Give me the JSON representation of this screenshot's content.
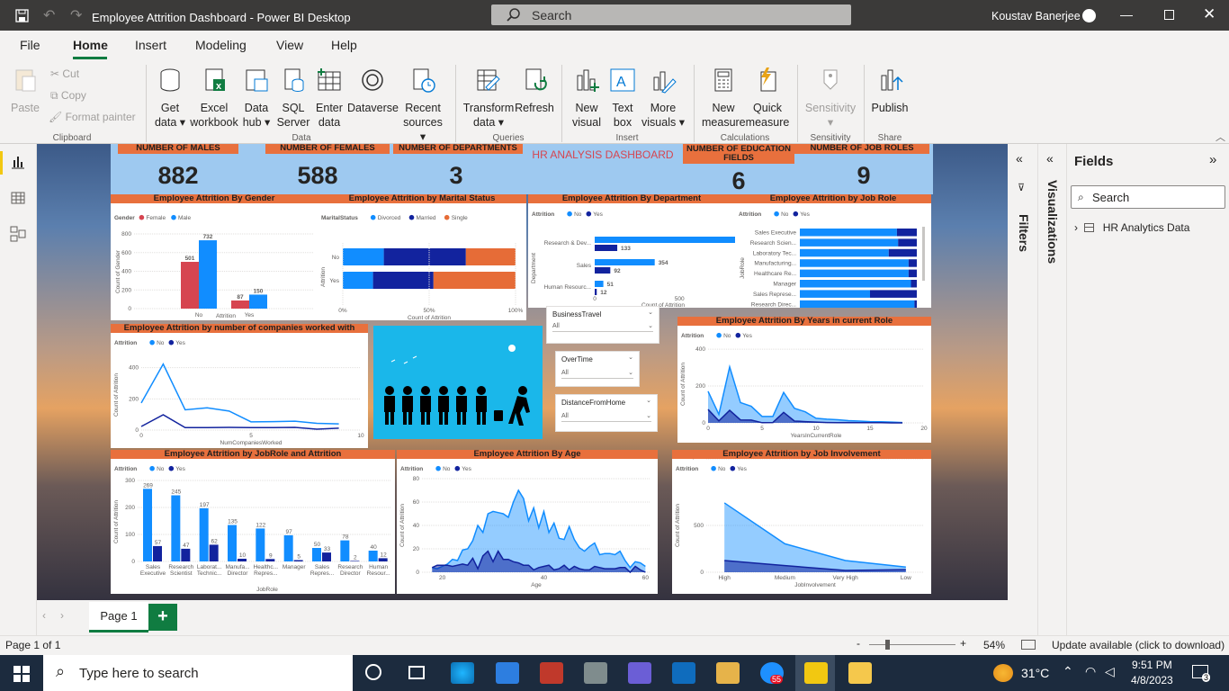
{
  "window": {
    "title": "Employee Attrition Dashboard - Power BI Desktop",
    "search_placeholder": "Search",
    "user": "Koustav Banerjee"
  },
  "menu": [
    "File",
    "Home",
    "Insert",
    "Modeling",
    "View",
    "Help"
  ],
  "ribbon": {
    "clipboard": {
      "paste": "Paste",
      "cut": "Cut",
      "copy": "Copy",
      "format_painter": "Format painter",
      "group": "Clipboard"
    },
    "data": {
      "get_data": [
        "Get",
        "data"
      ],
      "excel": [
        "Excel",
        "workbook"
      ],
      "data_hub": [
        "Data",
        "hub"
      ],
      "sql": [
        "SQL",
        "Server"
      ],
      "enter": [
        "Enter",
        "data"
      ],
      "dataverse": "Dataverse",
      "recent": [
        "Recent",
        "sources"
      ],
      "group": "Data"
    },
    "queries": {
      "transform": [
        "Transform",
        "data"
      ],
      "refresh": "Refresh",
      "group": "Queries"
    },
    "insert": {
      "new_visual": [
        "New",
        "visual"
      ],
      "text_box": [
        "Text",
        "box"
      ],
      "more_visuals": [
        "More",
        "visuals"
      ],
      "group": "Insert"
    },
    "calculations": {
      "new_measure": [
        "New",
        "measure"
      ],
      "quick_measure": [
        "Quick",
        "measure"
      ],
      "group": "Calculations"
    },
    "sensitivity": {
      "label": "Sensitivity",
      "group": "Sensitivity"
    },
    "share": {
      "publish": "Publish",
      "group": "Share"
    }
  },
  "dashboard": {
    "kpis": [
      {
        "label": "NUMBER OF MALES",
        "value": "882"
      },
      {
        "label": "NUMBER OF FEMALES",
        "value": "588"
      },
      {
        "label": "NUMBER OF DEPARTMENTS",
        "value": "3"
      },
      {
        "label": "NUMBER OF EDUCATION FIELDS",
        "value": "6"
      },
      {
        "label": "NUMBER OF JOB ROLES",
        "value": "9"
      }
    ],
    "title": "HR ANALYSIS DASHBOARD",
    "slicers": [
      {
        "label": "BusinessTravel",
        "value": "All"
      },
      {
        "label": "OverTime",
        "value": "All"
      },
      {
        "label": "DistanceFromHome",
        "value": "All"
      }
    ]
  },
  "chart_data": [
    {
      "type": "bar",
      "title": "Employee Attrition By Gender",
      "legend_title": "Gender",
      "xlabel": "Attrition",
      "ylabel": "Count of Gender",
      "categories": [
        "No",
        "Yes"
      ],
      "series": [
        {
          "name": "Female",
          "values": [
            501,
            87
          ]
        },
        {
          "name": "Male",
          "values": [
            732,
            150
          ]
        }
      ],
      "ylim": [
        0,
        800
      ],
      "yticks": [
        0,
        200,
        400,
        600,
        800
      ],
      "colors": [
        "#d64550",
        "#118dff"
      ]
    },
    {
      "type": "bar",
      "title": "Employee Attrition by Marital Status",
      "legend_title": "MaritalStatus",
      "xlabel": "Count of Attrition",
      "ylabel": "Attrition",
      "categories": [
        "No",
        "Yes"
      ],
      "series": [
        {
          "name": "Divorced",
          "values": [
            0.19,
            0.14
          ]
        },
        {
          "name": "Married",
          "values": [
            0.38,
            0.28
          ]
        },
        {
          "name": "Single",
          "values": [
            0.23,
            0.41
          ]
        }
      ],
      "stacked_100": true,
      "xticks": [
        "0%",
        "50%",
        "100%"
      ],
      "colors": [
        "#118dff",
        "#12239e",
        "#e66c37"
      ]
    },
    {
      "type": "bar",
      "title": "Employee Attrition By Department",
      "legend_title": "Attrition",
      "xlabel": "Count of Attrition",
      "ylabel": "Department",
      "categories": [
        "Research & Dev...",
        "Sales",
        "Human Resourc..."
      ],
      "series": [
        {
          "name": "No",
          "values": [
            828,
            354,
            51
          ]
        },
        {
          "name": "Yes",
          "values": [
            133,
            92,
            12
          ]
        }
      ],
      "xticks": [
        0,
        500
      ],
      "colors": [
        "#118dff",
        "#12239e"
      ]
    },
    {
      "type": "bar",
      "title": "Employee Attrition by Job Role",
      "legend_title": "Attrition",
      "ylabel": "JobRole",
      "categories": [
        "Sales Executive",
        "Research Scien...",
        "Laboratory Tec...",
        "Manufacturing...",
        "Healthcare Re...",
        "Manager",
        "Sales Represe...",
        "Research Direc..."
      ],
      "series": [
        {
          "name": "No",
          "values": [
            0.83,
            0.84,
            0.76,
            0.93,
            0.93,
            0.95,
            0.6,
            0.98
          ]
        },
        {
          "name": "Yes",
          "values": [
            0.17,
            0.16,
            0.24,
            0.07,
            0.07,
            0.05,
            0.4,
            0.02
          ]
        }
      ],
      "stacked_100": true,
      "colors": [
        "#118dff",
        "#12239e"
      ]
    },
    {
      "type": "line",
      "title": "Employee Attrition by number of companies worked with",
      "legend_title": "Attrition",
      "xlabel": "NumCompaniesWorked",
      "ylabel": "Count of Attrition",
      "x": [
        0,
        1,
        2,
        3,
        4,
        5,
        6,
        7,
        8,
        9
      ],
      "series": [
        {
          "name": "No",
          "values": [
            174,
            423,
            130,
            143,
            122,
            53,
            54,
            57,
            43,
            40
          ]
        },
        {
          "name": "Yes",
          "values": [
            23,
            98,
            16,
            16,
            17,
            16,
            16,
            17,
            6,
            12
          ]
        }
      ],
      "xticks": [
        0,
        5,
        10
      ],
      "yticks": [
        0,
        200,
        400
      ],
      "ylim": [
        0,
        450
      ],
      "colors": [
        "#118dff",
        "#12239e"
      ]
    },
    {
      "type": "area",
      "title": "Employee Attrition By Years in current Role",
      "legend_title": "Attrition",
      "xlabel": "YearsInCurrentRole",
      "ylabel": "Count of Attrition",
      "x": [
        0,
        1,
        2,
        3,
        4,
        5,
        6,
        7,
        8,
        9,
        10,
        11,
        12,
        13,
        14,
        15,
        16,
        17,
        18
      ],
      "series": [
        {
          "name": "No",
          "values": [
            171,
            46,
            304,
            110,
            90,
            35,
            35,
            165,
            79,
            60,
            25,
            20,
            17,
            12,
            10,
            7,
            6,
            4,
            2
          ]
        },
        {
          "name": "Yes",
          "values": [
            73,
            11,
            68,
            16,
            15,
            1,
            2,
            57,
            10,
            7,
            4,
            2,
            1,
            2,
            1,
            1,
            1,
            0,
            0
          ]
        }
      ],
      "xticks": [
        0,
        5,
        10,
        15,
        20
      ],
      "yticks": [
        0,
        200,
        400
      ],
      "ylim": [
        0,
        420
      ],
      "colors": [
        "#118dff",
        "#12239e"
      ]
    },
    {
      "type": "bar",
      "title": "Employee Attrition by JobRole and Attrition",
      "legend_title": "Attrition",
      "xlabel": "JobRole",
      "ylabel": "Count of Attrition",
      "categories": [
        "Sales Executive",
        "Research Scientist",
        "Laborat... Technic...",
        "Manufa... Director",
        "Healthc... Repres...",
        "Manager",
        "Sales Repres...",
        "Research Director",
        "Human Resour..."
      ],
      "series": [
        {
          "name": "No",
          "values": [
            269,
            245,
            197,
            135,
            122,
            97,
            50,
            78,
            40
          ]
        },
        {
          "name": "Yes",
          "values": [
            57,
            47,
            62,
            10,
            9,
            5,
            33,
            2,
            12
          ]
        }
      ],
      "yticks": [
        0,
        100,
        200,
        300
      ],
      "ylim": [
        0,
        300
      ],
      "colors": [
        "#118dff",
        "#12239e"
      ]
    },
    {
      "type": "area",
      "title": "Employee Attrition By Age",
      "legend_title": "Attrition",
      "xlabel": "Age",
      "ylabel": "Count of Attrition",
      "x": [
        18,
        19,
        20,
        21,
        22,
        23,
        24,
        25,
        26,
        27,
        28,
        29,
        30,
        31,
        32,
        33,
        34,
        35,
        36,
        37,
        38,
        39,
        40,
        41,
        42,
        43,
        44,
        45,
        46,
        47,
        48,
        49,
        50,
        51,
        52,
        53,
        54,
        55,
        56,
        57,
        58,
        59,
        60
      ],
      "series": [
        {
          "name": "No",
          "values": [
            4,
            3,
            5,
            7,
            11,
            10,
            19,
            20,
            27,
            40,
            34,
            50,
            52,
            51,
            50,
            47,
            60,
            70,
            63,
            44,
            55,
            38,
            52,
            34,
            42,
            29,
            28,
            39,
            28,
            21,
            18,
            22,
            25,
            15,
            16,
            16,
            15,
            18,
            10,
            4,
            9,
            8,
            5
          ]
        },
        {
          "name": "Yes",
          "values": [
            4,
            6,
            6,
            6,
            5,
            6,
            7,
            6,
            12,
            3,
            14,
            18,
            9,
            18,
            11,
            11,
            9,
            8,
            6,
            6,
            2,
            4,
            5,
            6,
            2,
            3,
            6,
            2,
            5,
            3,
            2,
            2,
            5,
            4,
            3,
            3,
            3,
            4,
            4,
            0,
            5,
            2,
            0
          ]
        }
      ],
      "xticks": [
        20,
        40,
        60
      ],
      "yticks": [
        0,
        20,
        40,
        60,
        80
      ],
      "ylim": [
        0,
        80
      ],
      "colors": [
        "#118dff",
        "#12239e"
      ]
    },
    {
      "type": "area",
      "title": "Employee Attrition by Job Involvement",
      "legend_title": "Attrition",
      "xlabel": "JobInvolvement",
      "ylabel": "Count of Attrition",
      "categories": [
        "High",
        "Medium",
        "Very High",
        "Low"
      ],
      "series": [
        {
          "name": "No",
          "values": [
            741,
            304,
            125,
            55
          ]
        },
        {
          "name": "Yes",
          "values": [
            125,
            71,
            19,
            28
          ]
        }
      ],
      "yticks": [
        "0",
        "500",
        "1,000"
      ],
      "ylim": [
        0,
        1000
      ],
      "colors": [
        "#118dff",
        "#12239e"
      ]
    }
  ],
  "panes": {
    "filters": "Filters",
    "visualizations": "Visualizations",
    "fields_title": "Fields",
    "search_placeholder": "Search",
    "table": "HR Analytics Data"
  },
  "pages": {
    "current": "Page 1",
    "add": "+"
  },
  "status": {
    "page_info": "Page 1 of 1",
    "zoom": "54%",
    "update": "Update available (click to download)"
  },
  "taskbar": {
    "search_placeholder": "Type here to search",
    "weather": "31°C",
    "time": "9:51 PM",
    "date": "4/8/2023",
    "notifications": "3",
    "edge_badge": "55"
  }
}
